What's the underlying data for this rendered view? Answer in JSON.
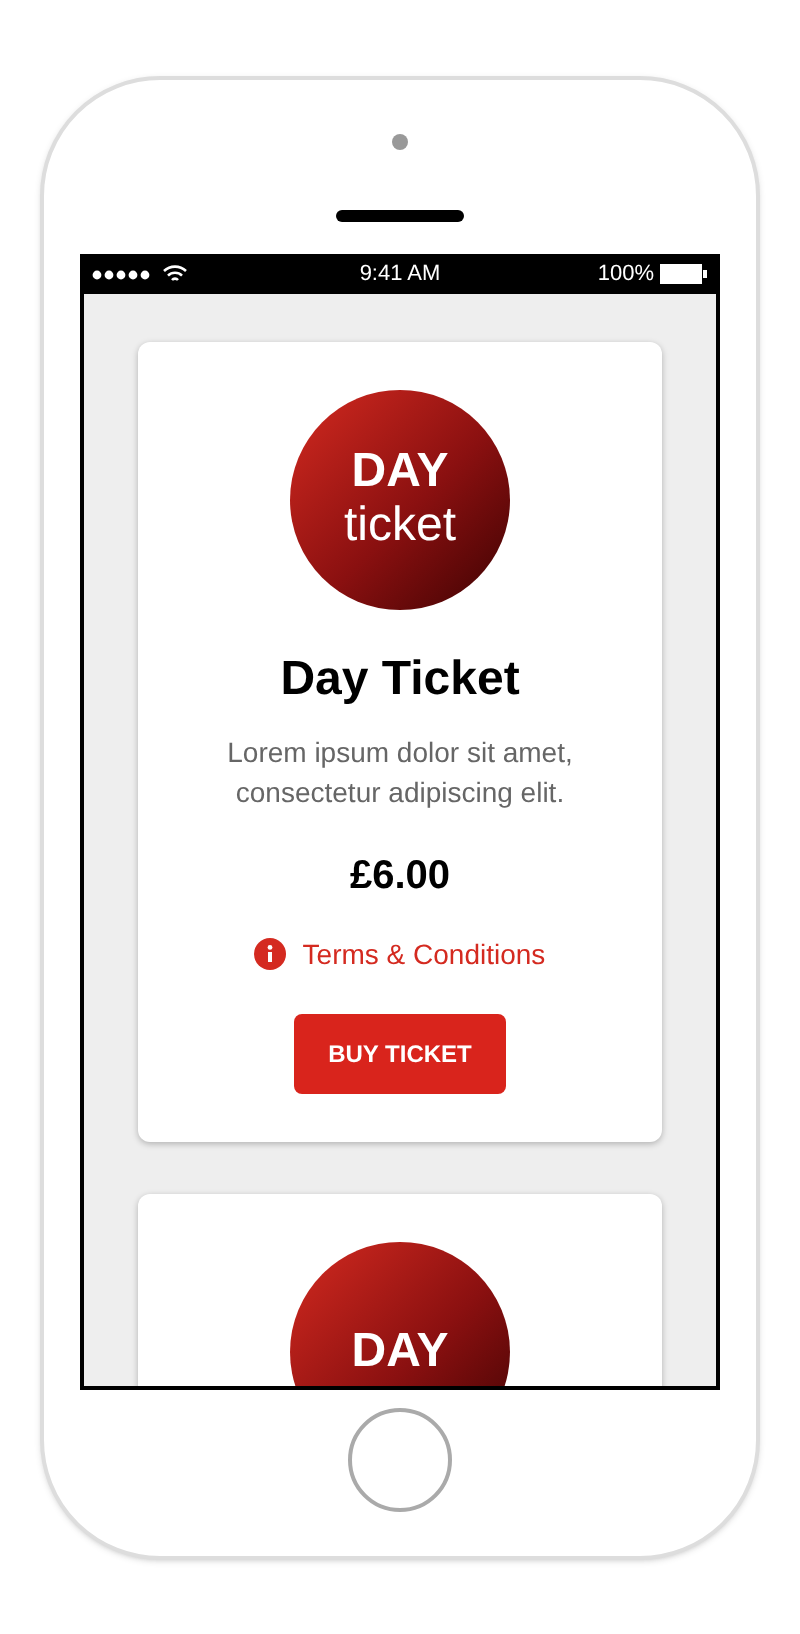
{
  "status_bar": {
    "time": "9:41 AM",
    "battery": "100%"
  },
  "tickets": [
    {
      "badge_top": "DAY",
      "badge_bottom": "ticket",
      "title": "Day Ticket",
      "description": "Lorem ipsum dolor sit amet, consectetur adipiscing elit.",
      "price": "£6.00",
      "terms_link": "Terms & Conditions",
      "button": "BUY TICKET"
    },
    {
      "badge_top": "DAY"
    }
  ]
}
